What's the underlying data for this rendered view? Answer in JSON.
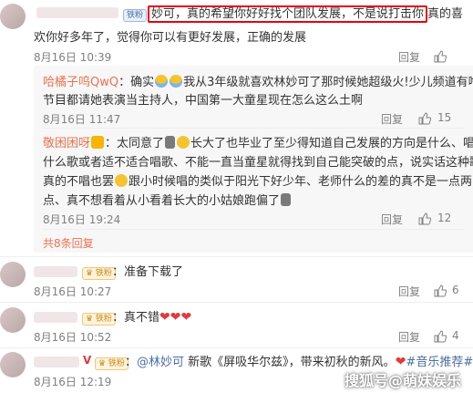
{
  "c1": {
    "badge": "铁粉",
    "line1_highlight": "妙可，真的希望你好好找个团队发展，不是说打击你",
    "line1_tail": "真的喜",
    "line2": "欢你好多年了，觉得你可以有更好发展，正确的发展",
    "date": "8月16日 10:39",
    "reply": "回复",
    "likes": ""
  },
  "r1": {
    "user": "哈橘子呜QwQ",
    "line1_pre": "：确实",
    "line1_post": "我从3年级就喜欢林妙可了那时候她超级火!少儿频道有啥",
    "line2": "节目都请她表演当主持人，中国第一大童星现在怎么这么土啊",
    "date": "8月16日 11:47",
    "reply": "回复",
    "likes": "15"
  },
  "r2": {
    "user": "敬困困呀",
    "line1_pre": "：太同意了",
    "line1_post": "长大了也毕业了至少得知道自己发展的方向是什么、唱",
    "line2": "什么歌或者适不适合唱歌、不能一直当童星就得找到自己能突破的点，说实话这种歌",
    "line3_pre": "真的不唱也罢",
    "line3_post": "跟小时候唱的类似于阳光下好少年、老师什么的差的真不是一点两",
    "line4": "点、真不想看着从小看着长大的小姑娘跑偏了",
    "date": "8月16日 19:24",
    "reply": "回复",
    "likes": "12"
  },
  "more": "共8条回复",
  "c2": {
    "text": "：准备下载了",
    "date": "8月16日 10:27",
    "reply": "回复",
    "likes": "6"
  },
  "c3": {
    "text": "：真不错",
    "date": "8月16日 10:52",
    "reply": "回复",
    "likes": "4"
  },
  "c4": {
    "mention": "@林妙可",
    "text_mid": "新歌《屏吸华尔兹》，带来初秋的新风。",
    "hashtag": "#音乐推荐#",
    "date": "8月16日 12:19",
    "reply": "回复"
  },
  "watermark": "搜狐号@萌妹娱乐",
  "colors": {
    "highlight_border": "#e60012",
    "username": "#eb7350",
    "mention": "#4b6ea6",
    "heart": "#e4393c"
  }
}
